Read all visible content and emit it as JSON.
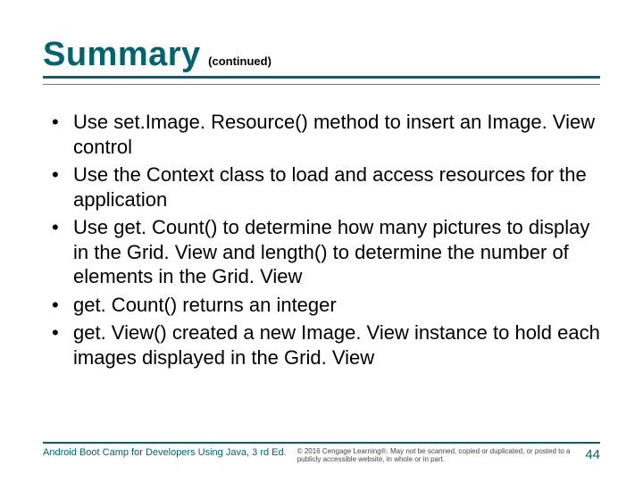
{
  "title": "Summary",
  "continued": "(continued)",
  "bullets": [
    "Use set.Image. Resource() method to insert an Image. View control",
    "Use the Context class to load and access resources for the application",
    "Use get. Count() to determine how many pictures to display in the Grid. View and length() to determine the number of elements in the Grid. View",
    "get. Count() returns an integer",
    "get. View() created a new Image. View instance to hold each images displayed in the Grid. View"
  ],
  "footer": {
    "source": "Android Boot Camp for Developers Using Java, 3 rd Ed.",
    "copyright": "© 2016 Cengage Learning®. May not be scanned, copied or duplicated, or posted to a publicly accessible website, in whole or in part.",
    "page": "44"
  }
}
